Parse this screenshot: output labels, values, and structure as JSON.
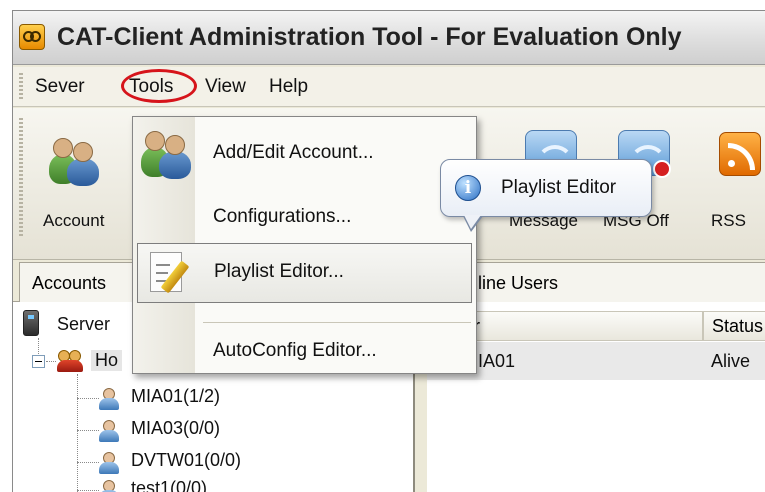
{
  "window": {
    "title": "CAT-Client Administration Tool - For Evaluation Only"
  },
  "menubar": {
    "items": [
      "Sever",
      "Tools",
      "View",
      "Help"
    ]
  },
  "toolbar": {
    "account_label": "Account",
    "message_label": "Message",
    "msg_off_label": "MSG Off",
    "rss_label": "RSS"
  },
  "tabs": {
    "accounts": "Accounts",
    "online_users": "Online Users"
  },
  "tree": {
    "root": "Server",
    "group": "Ho",
    "children": [
      "MIA01(1/2)",
      "MIA03(0/0)",
      "DVTW01(0/0)",
      "test1(0/0)"
    ]
  },
  "list": {
    "columns": [
      "er",
      "Status"
    ],
    "rows": [
      {
        "user": "MIA01",
        "status": "Alive"
      }
    ]
  },
  "tools_menu": {
    "items": [
      "Add/Edit Account...",
      "Configurations...",
      "Playlist Editor...",
      "AutoConfig Editor..."
    ],
    "highlighted_index": 2
  },
  "tooltip": {
    "text": "Playlist Editor"
  },
  "colors": {
    "annotation_circle": "#d6141b",
    "status_alive": "#2a9a18"
  }
}
